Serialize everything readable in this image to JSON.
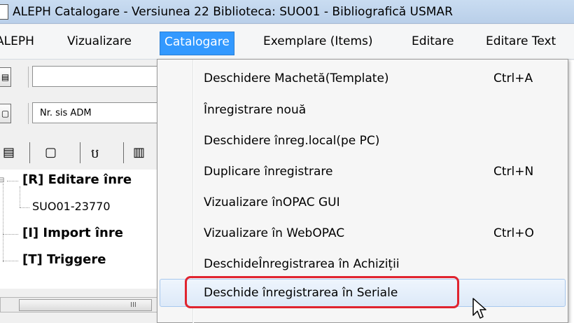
{
  "window": {
    "title": "ALEPH Catalogare - Versiunea 22  Biblioteca:  SUO01 - Bibliografică USMAR"
  },
  "menubar": {
    "items": [
      {
        "label": "ALEPH"
      },
      {
        "label": "Vizualizare"
      },
      {
        "label": "Catalogare"
      },
      {
        "label": "Exemplare (Items)"
      },
      {
        "label": "Editare"
      },
      {
        "label": "Editare Text"
      }
    ]
  },
  "left": {
    "field1_value": "",
    "field2_value": "Nr. sis ADM",
    "tree": {
      "node_r": "[R] Editare înre",
      "node_r_child": "SUO01-23770",
      "node_i": "[I] Import înre",
      "node_t": "[T] Triggere"
    },
    "scroll_grip": "III"
  },
  "dropdown": {
    "items": [
      {
        "label": "Deschidere Machetă(Template)",
        "shortcut": "Ctrl+A"
      },
      {
        "label": "Înregistrare nouă",
        "shortcut": ""
      },
      {
        "label": "Deschidere înreg.local(pe PC)",
        "shortcut": ""
      },
      {
        "label": "Duplicare înregistrare",
        "shortcut": "Ctrl+N"
      },
      {
        "label": "Vizualizare înOPAC GUI",
        "shortcut": ""
      },
      {
        "label": "Vizualizare în WebOPAC",
        "shortcut": "Ctrl+O"
      },
      {
        "label": "DeschideÎnregistrarea în Achiziții",
        "shortcut": ""
      },
      {
        "label": "Deschide înregistrarea în Seriale",
        "shortcut": ""
      }
    ],
    "highlight_color": "#e0242f",
    "active_menu_color": "#3399ff"
  }
}
